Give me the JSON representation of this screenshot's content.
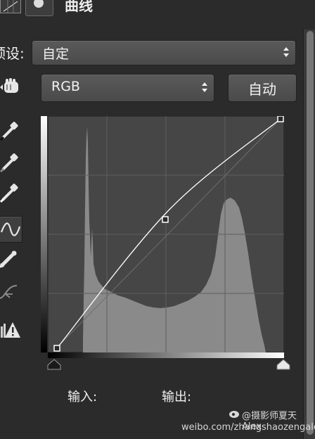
{
  "header": {
    "title": "曲线",
    "adjustment_icon": "curves-adjustment-icon",
    "mask_icon": "layer-mask-icon"
  },
  "preset": {
    "label": "预设:",
    "value": "自定"
  },
  "channel": {
    "value": "RGB"
  },
  "auto_button": {
    "label": "自动"
  },
  "tools": [
    "on-image-adjust-hand-icon",
    "black-point-eyedropper-icon",
    "gray-point-eyedropper-icon",
    "white-point-eyedropper-icon",
    "curve-point-tool-icon",
    "pencil-draw-icon",
    "smooth-curve-icon",
    "clipping-warning-icon"
  ],
  "curve": {
    "points": [
      [
        0,
        0
      ],
      [
        128,
        154
      ],
      [
        255,
        255
      ]
    ],
    "input_range": [
      0,
      255
    ],
    "output_range": [
      0,
      255
    ],
    "grid": "4x4"
  },
  "readout": {
    "input_label": "输入:",
    "output_label": "输出:"
  },
  "watermark": {
    "handle": "@摄影师夏天Alex",
    "url": "weibo.com/zhangshaozengalex"
  },
  "colors": {
    "panel": "#2b2b2b",
    "graph_bg": "#464646",
    "histogram": "#8a8a8a",
    "curve": "#ffffff"
  }
}
